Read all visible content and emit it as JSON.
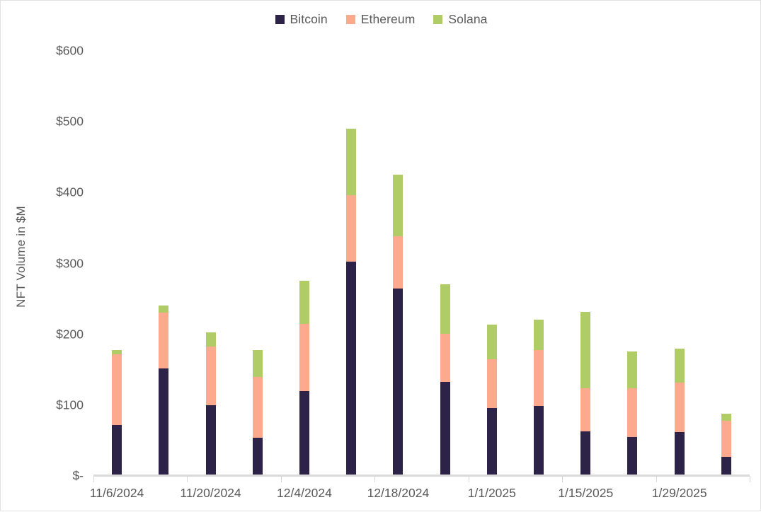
{
  "legend": {
    "position": "top-center",
    "entries": [
      {
        "label": "Bitcoin",
        "color": "#2D2247"
      },
      {
        "label": "Ethereum",
        "color": "#FCA98D"
      },
      {
        "label": "Solana",
        "color": "#AFCC66"
      }
    ]
  },
  "axes": {
    "y_title": "NFT Volume in $M",
    "y_ticks": [
      "$600",
      "$500",
      "$400",
      "$300",
      "$200",
      "$100",
      "$-"
    ],
    "x_ticks_visible": [
      "11/6/2024",
      "11/20/2024",
      "12/4/2024",
      "12/18/2024",
      "1/1/2025",
      "1/15/2025",
      "1/29/2025"
    ]
  },
  "chart_data": {
    "type": "bar",
    "stacked": true,
    "title": "",
    "xlabel": "",
    "ylabel": "NFT Volume in $M",
    "ylim": [
      0,
      600
    ],
    "ytick_values": [
      0,
      100,
      200,
      300,
      400,
      500,
      600
    ],
    "ytick_labels": [
      "$-",
      "$100",
      "$200",
      "$300",
      "$400",
      "$500",
      "$600"
    ],
    "grid": false,
    "legend_position": "top-center",
    "categories": [
      "11/6/2024",
      "11/13/2024",
      "11/20/2024",
      "11/27/2024",
      "12/4/2024",
      "12/11/2024",
      "12/18/2024",
      "12/25/2024",
      "1/1/2025",
      "1/8/2025",
      "1/15/2025",
      "1/22/2025",
      "1/29/2025",
      "2/5/2025"
    ],
    "labeled_categories": [
      "11/6/2024",
      "11/20/2024",
      "12/4/2024",
      "12/18/2024",
      "1/1/2025",
      "1/15/2025",
      "1/29/2025"
    ],
    "series": [
      {
        "name": "Bitcoin",
        "color": "#2D2247",
        "values": [
          72,
          152,
          100,
          54,
          120,
          303,
          265,
          133,
          96,
          99,
          63,
          55,
          62,
          27
        ]
      },
      {
        "name": "Ethereum",
        "color": "#FCA98D",
        "values": [
          100,
          79,
          83,
          86,
          95,
          93,
          73,
          68,
          69,
          79,
          61,
          69,
          70,
          51
        ]
      },
      {
        "name": "Solana",
        "color": "#AFCC66",
        "values": [
          6,
          10,
          20,
          38,
          61,
          94,
          87,
          70,
          49,
          43,
          108,
          52,
          48,
          10
        ]
      }
    ],
    "totals": [
      178,
      241,
      203,
      178,
      276,
      490,
      425,
      271,
      214,
      221,
      232,
      176,
      180,
      88
    ]
  },
  "style": {
    "background": "#ffffff",
    "text_color": "#595959",
    "axis_line_color": "#d9d9d9"
  }
}
